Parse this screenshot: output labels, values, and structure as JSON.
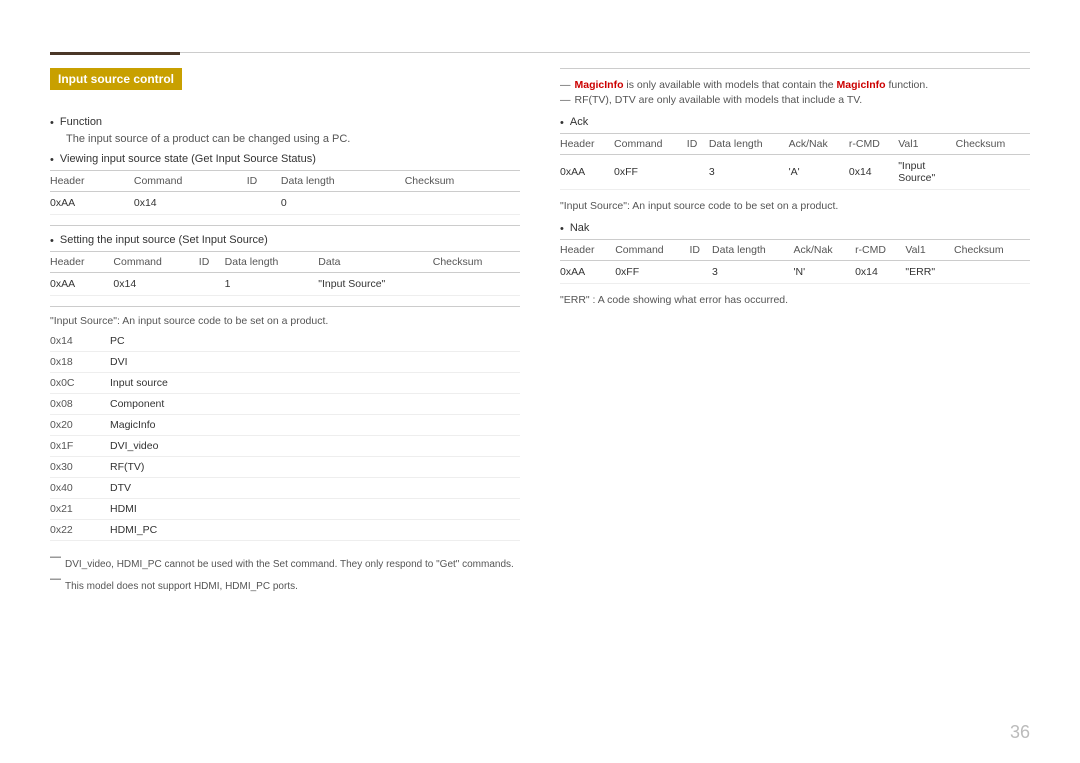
{
  "page": {
    "number": "36",
    "top_accent_color": "#4a3728",
    "header_rule_color": "#ccc"
  },
  "left": {
    "section_title": "Input source control",
    "function_bullet": "Function",
    "function_sub": "The input source of a product can be changed using a PC.",
    "viewing_bullet": "Viewing input source state (Get Input Source Status)",
    "viewing_table": {
      "headers": [
        "Header",
        "Command",
        "ID",
        "Data length",
        "Checksum"
      ],
      "rows": [
        [
          "0xAA",
          "0x14",
          "",
          "0",
          ""
        ]
      ]
    },
    "setting_bullet": "Setting the input source (Set Input Source)",
    "setting_table": {
      "headers": [
        "Header",
        "Command",
        "ID",
        "Data length",
        "Data",
        "Checksum"
      ],
      "rows": [
        [
          "0xAA",
          "0x14",
          "",
          "1",
          "\"Input Source\"",
          ""
        ]
      ]
    },
    "source_note": "\"Input Source\": An input source code to be set on a product.",
    "source_codes": [
      {
        "code": "0x14",
        "label": "PC"
      },
      {
        "code": "0x18",
        "label": "DVI"
      },
      {
        "code": "0x0C",
        "label": "Input source"
      },
      {
        "code": "0x08",
        "label": "Component"
      },
      {
        "code": "0x20",
        "label": "MagicInfo"
      },
      {
        "code": "0x1F",
        "label": "DVI_video"
      },
      {
        "code": "0x30",
        "label": "RF(TV)"
      },
      {
        "code": "0x40",
        "label": "DTV"
      },
      {
        "code": "0x21",
        "label": "HDMI"
      },
      {
        "code": "0x22",
        "label": "HDMI_PC"
      }
    ],
    "footnotes": [
      "DVI_video, HDMI_PC cannot be used with the Set command. They only respond to \"Get\" commands.",
      "This model does not support HDMI, HDMI_PC ports."
    ]
  },
  "right": {
    "magicinfo_note": " is only available with models that contain the ",
    "magicinfo_bold1": "MagicInfo",
    "magicinfo_bold2": "MagicInfo",
    "magicinfo_suffix": " function.",
    "rf_note": "RF(TV), DTV are only available with models that include a TV.",
    "ack_bullet": "Ack",
    "ack_table": {
      "headers": [
        "Header",
        "Command",
        "ID",
        "Data length",
        "Ack/Nak",
        "r-CMD",
        "Val1",
        "Checksum"
      ],
      "rows": [
        [
          "0xAA",
          "0xFF",
          "",
          "3",
          "'A'",
          "0x14",
          "\"Input Source\"",
          ""
        ]
      ]
    },
    "ack_note": "\"Input Source\": An input source code to be set on a product.",
    "nak_bullet": "Nak",
    "nak_table": {
      "headers": [
        "Header",
        "Command",
        "ID",
        "Data length",
        "Ack/Nak",
        "r-CMD",
        "Val1",
        "Checksum"
      ],
      "rows": [
        [
          "0xAA",
          "0xFF",
          "",
          "3",
          "'N'",
          "0x14",
          "\"ERR\"",
          ""
        ]
      ]
    },
    "err_note": "\"ERR\" : A code showing what error has occurred."
  }
}
